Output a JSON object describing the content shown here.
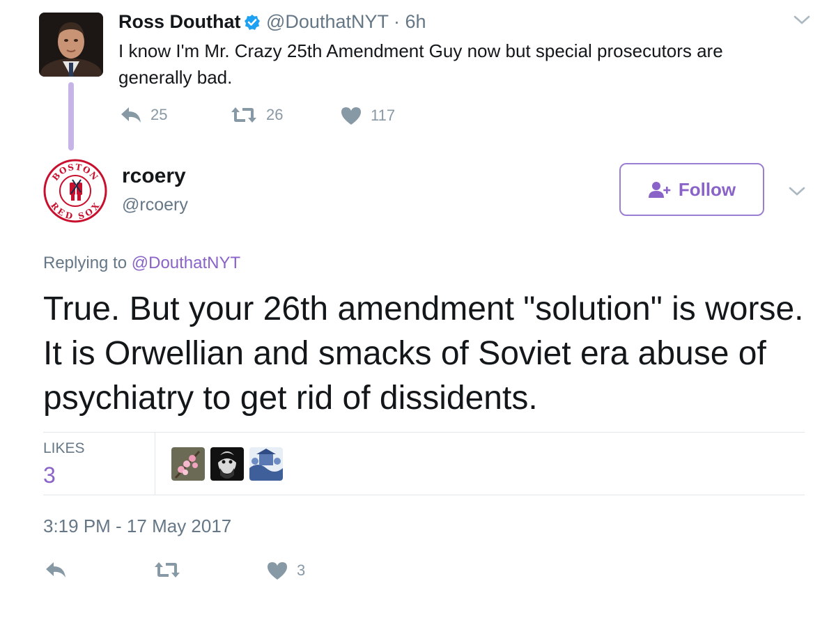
{
  "parent_tweet": {
    "name": "Ross Douthat",
    "handle_time": "@DouthatNYT · 6h",
    "text": "I know I'm Mr. Crazy 25th Amendment Guy now but special prosecutors are generally bad.",
    "reply_count": "25",
    "retweet_count": "26",
    "like_count": "117",
    "icons": [
      "verified-badge-icon",
      "chevron-down-icon",
      "reply-icon",
      "retweet-icon",
      "heart-icon"
    ]
  },
  "tweet": {
    "name": "rcoery",
    "handle": "@rcoery",
    "avatar_text_top": "BOSTON",
    "avatar_text_bottom": "RED SOX",
    "follow_label": "Follow",
    "replying_prefix": "Replying to",
    "replying_to": "@DouthatNYT",
    "text": "True. But your 26th amendment \"solution\" is worse. It is Orwellian and smacks of Soviet era abuse of psychiatry to get rid of dissidents.",
    "likes_label": "LIKES",
    "likes_count": "3",
    "timestamp": "3:19 PM - 17 May 2017",
    "like_action_count": "3",
    "icons": [
      "add-user-icon",
      "chevron-down-icon",
      "reply-icon",
      "retweet-icon",
      "heart-icon"
    ]
  },
  "colors": {
    "accent": "#8a63c9",
    "secondary_text": "#657786",
    "action_icons": "#8899a6",
    "verified": "#1da1f2",
    "thread_line": "#c6b4e6"
  }
}
